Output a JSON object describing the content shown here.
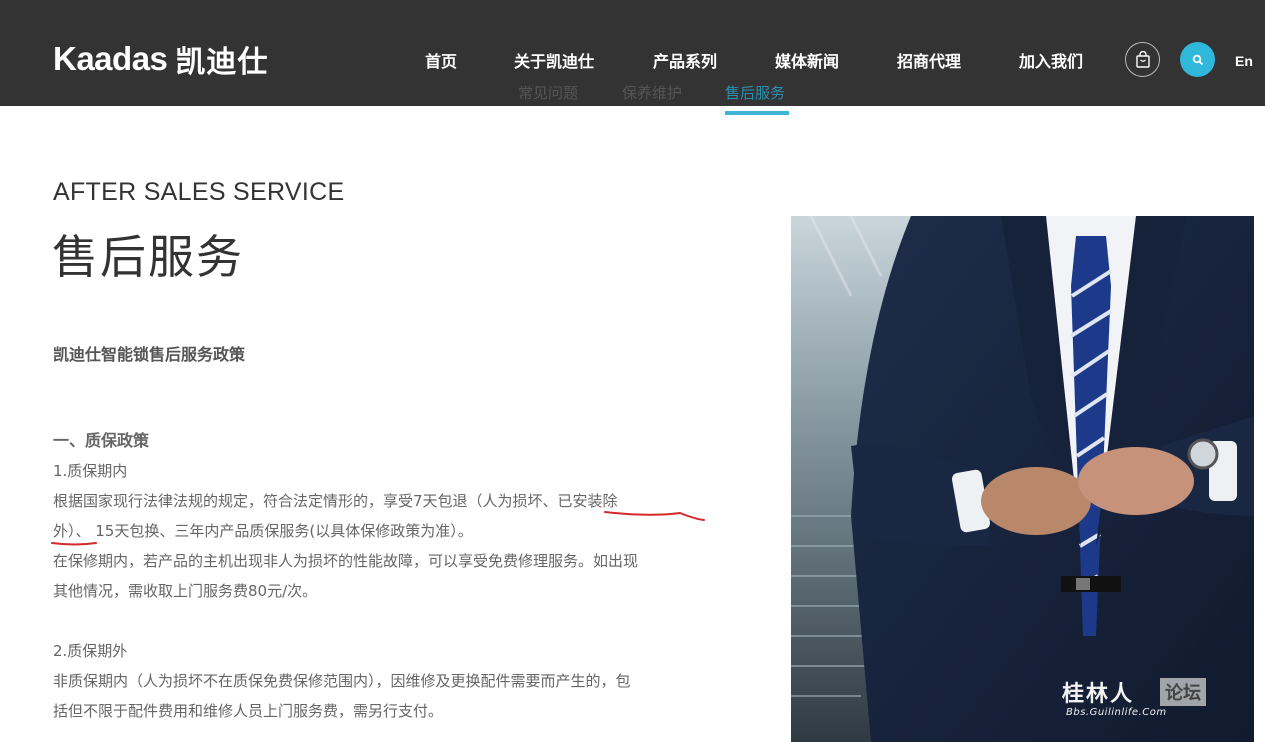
{
  "header": {
    "logo_latin": "Kaadas",
    "logo_cjk": "凯迪仕",
    "nav": [
      {
        "label": "首页"
      },
      {
        "label": "关于凯迪仕"
      },
      {
        "label": "产品系列"
      },
      {
        "label": "媒体新闻"
      },
      {
        "label": "招商代理"
      },
      {
        "label": "加入我们"
      }
    ],
    "lang": "En",
    "cart_icon": "shopping-bag-icon",
    "search_icon": "search-icon",
    "accent_color": "#2fb8d9",
    "bar_color": "#333333"
  },
  "subnav": [
    {
      "label": "常见问题",
      "active": false
    },
    {
      "label": "保养维护",
      "active": false
    },
    {
      "label": "售后服务",
      "active": true
    }
  ],
  "content": {
    "eyebrow": "AFTER SALES SERVICE",
    "title": "售后服务",
    "policy_title": "凯迪仕智能锁售后服务政策",
    "section1_heading": "一、质保政策",
    "sub1_heading": "1.质保期内",
    "sub1_line1": "根据国家现行法律法规的规定，符合法定情形的，享受7天包退（人为损坏、已安装除",
    "sub1_line2": "外）、 15天包换、三年内产品质保服务(以具体保修政策为准）。",
    "sub1_line3": "在保修期内，若产品的主机出现非人为损坏的性能故障，可以享受免费修理服务。如出现",
    "sub1_line4": "其他情况，需收取上门服务费80元/次。",
    "sub2_heading": "2.质保期外",
    "sub2_line1": "非质保期内（人为损坏不在质保免费保修范围内），因维修及更换配件需要而产生的，包",
    "sub2_line2": "括但不限于配件费用和维修人员上门服务费，需另行支付。"
  },
  "watermark": {
    "name": "桂林人",
    "tag": "论坛",
    "url": "Bbs.Guilinlife.Com"
  }
}
